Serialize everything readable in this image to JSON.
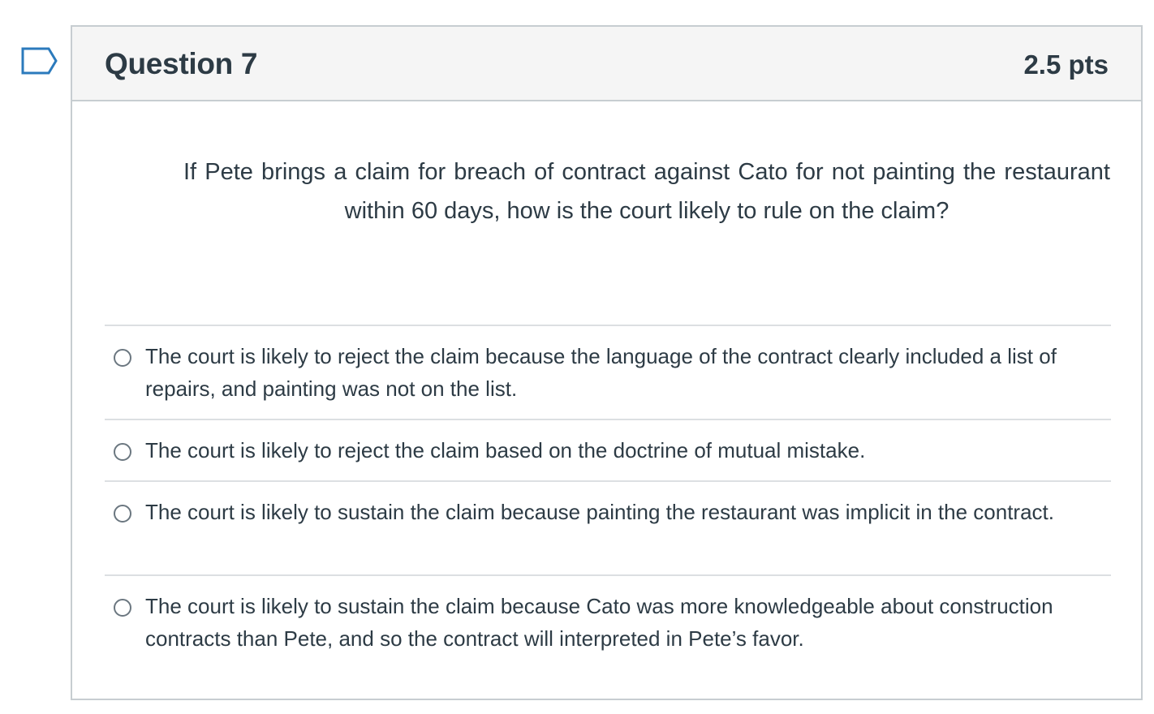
{
  "question": {
    "title": "Question 7",
    "points": "2.5 pts",
    "text": "If Pete brings a claim for breach of contract against Cato for not painting the restaurant within 60 days, how is the court likely to rule on the claim?"
  },
  "answers": [
    {
      "label": "The court is likely to reject the claim because the language of the contract clearly included a list of repairs, and painting was not on the list."
    },
    {
      "label": "The court is likely to reject the claim based on the doctrine of mutual mistake."
    },
    {
      "label": "The court is likely to sustain the claim because painting the restaurant was implicit in the contract."
    },
    {
      "label": "The court is likely to sustain the claim because Cato was more knowledgeable about construction contracts than Pete, and so the contract will interpreted in Pete’s favor."
    }
  ],
  "icons": {
    "flag": "flag-question-icon",
    "radio": "radio-unchecked-icon"
  },
  "colors": {
    "text": "#2d3b45",
    "border": "#c7cdd1",
    "header_bg": "#f5f5f5",
    "flag_stroke": "#2b7abc"
  }
}
